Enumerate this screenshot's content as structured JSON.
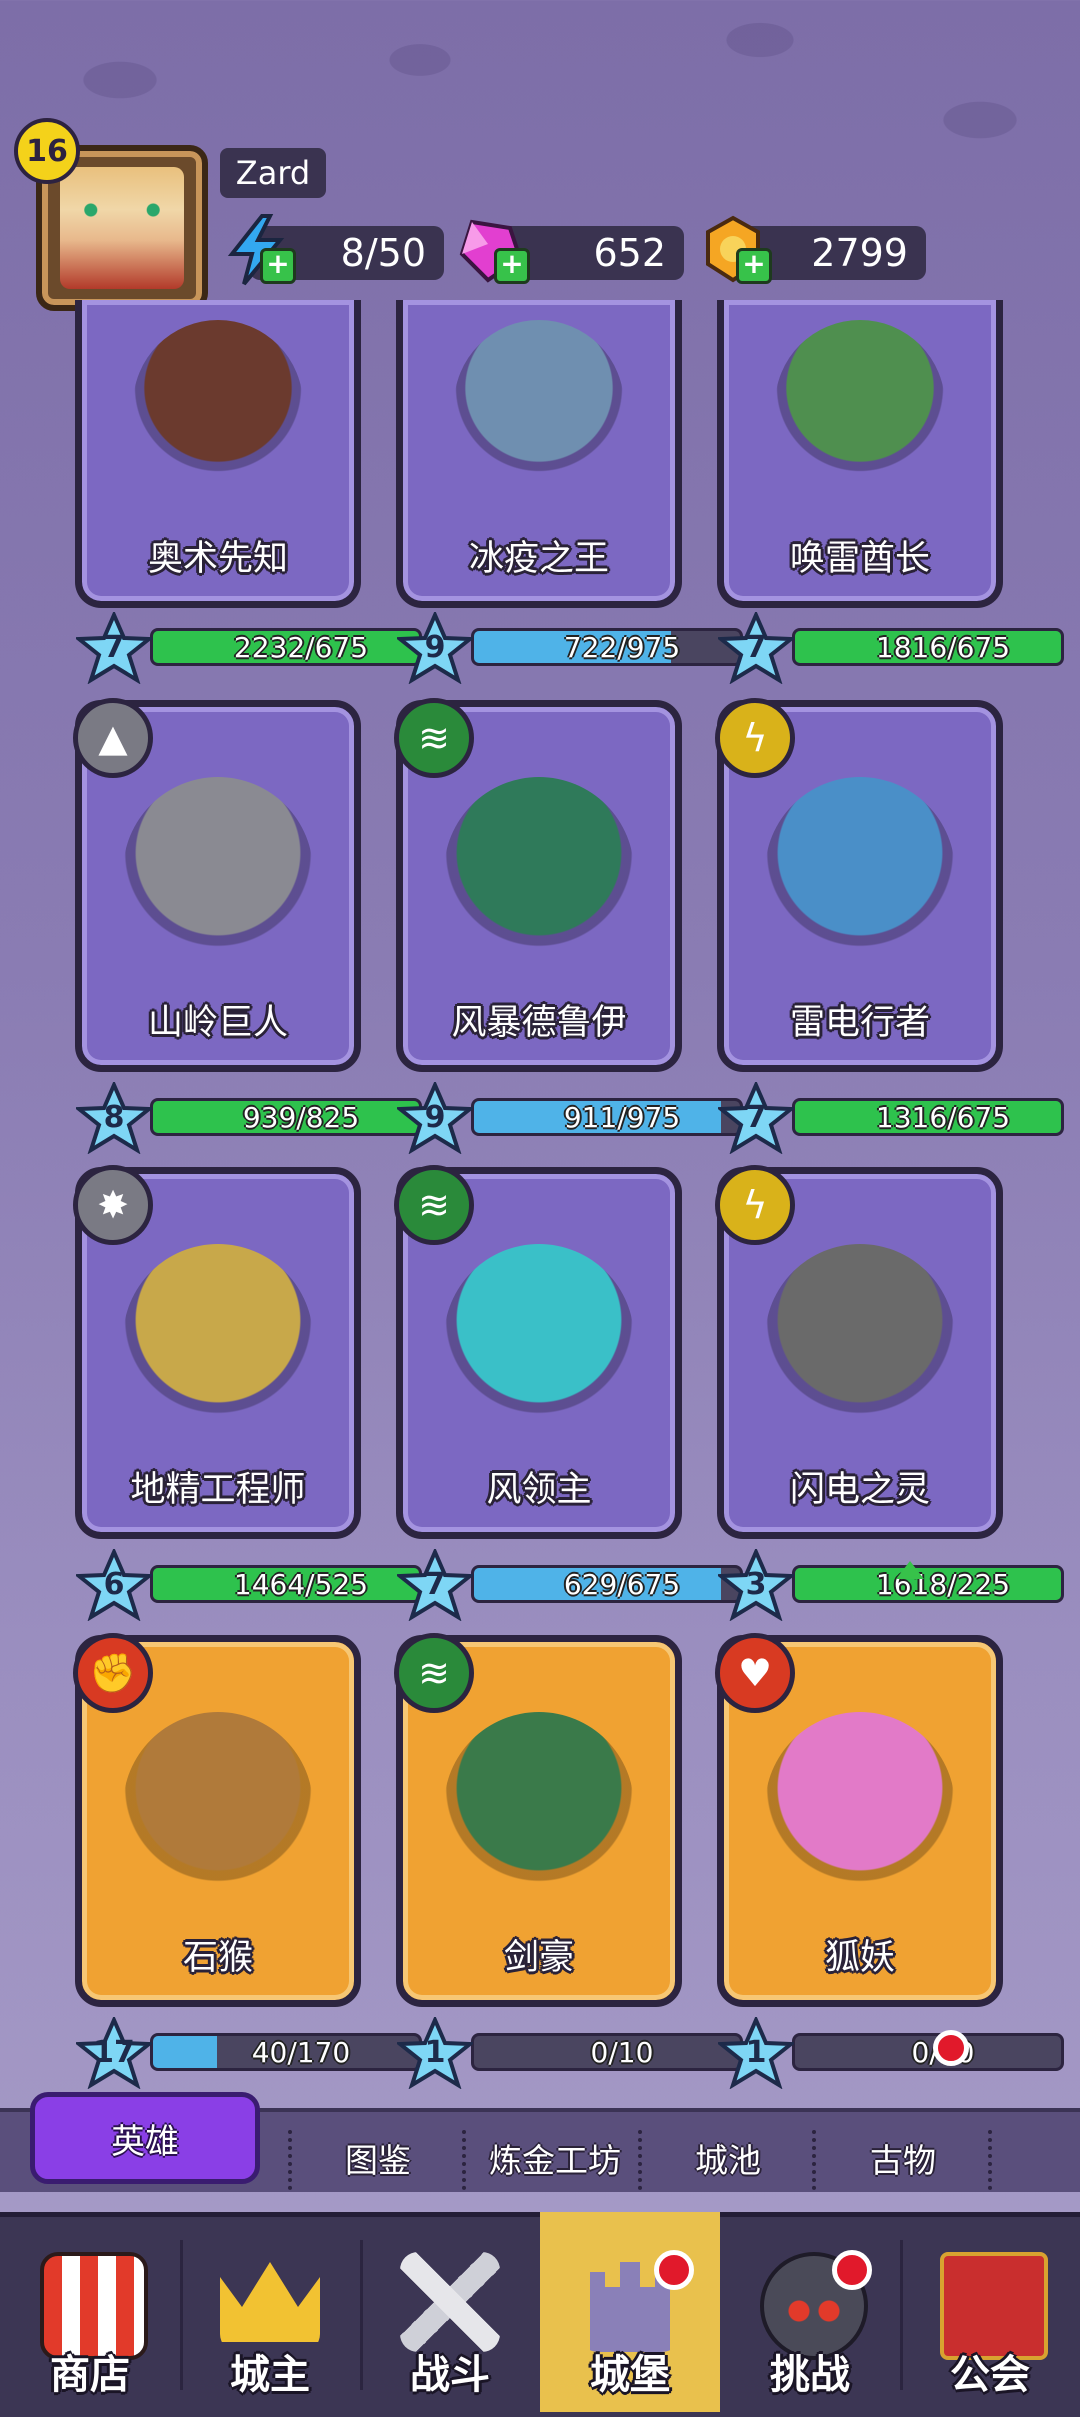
{
  "player": {
    "level": "16",
    "name": "Zard"
  },
  "resources": {
    "energy": "8/50",
    "gems": "652",
    "gold": "2799"
  },
  "heroes": [
    {
      "name": "奥术先知",
      "level": "7",
      "progress": "2232/675",
      "fill": 1.0,
      "bar_color": "#2ec24d",
      "element": "",
      "rarity": "epic"
    },
    {
      "name": "冰疫之王",
      "level": "9",
      "progress": "722/975",
      "fill": 0.74,
      "bar_color": "#4fb3e8",
      "element": "",
      "rarity": "epic"
    },
    {
      "name": "唤雷酋长",
      "level": "7",
      "progress": "1816/675",
      "fill": 1.0,
      "bar_color": "#2ec24d",
      "element": "",
      "rarity": "epic"
    },
    {
      "name": "山岭巨人",
      "level": "8",
      "progress": "939/825",
      "fill": 1.0,
      "bar_color": "#2ec24d",
      "element": "rock",
      "rarity": "epic"
    },
    {
      "name": "风暴德鲁伊",
      "level": "9",
      "progress": "911/975",
      "fill": 0.93,
      "bar_color": "#4fb3e8",
      "element": "wind",
      "rarity": "epic"
    },
    {
      "name": "雷电行者",
      "level": "7",
      "progress": "1316/675",
      "fill": 1.0,
      "bar_color": "#2ec24d",
      "element": "lightning",
      "rarity": "epic"
    },
    {
      "name": "地精工程师",
      "level": "6",
      "progress": "1464/525",
      "fill": 1.0,
      "bar_color": "#2ec24d",
      "element": "explosion",
      "rarity": "epic"
    },
    {
      "name": "风领主",
      "level": "7",
      "progress": "629/675",
      "fill": 0.93,
      "bar_color": "#4fb3e8",
      "element": "wind",
      "rarity": "epic"
    },
    {
      "name": "闪电之灵",
      "level": "3",
      "progress": "1618/225",
      "fill": 1.0,
      "bar_color": "#2ec24d",
      "element": "lightning",
      "rarity": "epic",
      "upgrade": true
    },
    {
      "name": "石猴",
      "level": "17",
      "progress": "40/170",
      "fill": 0.24,
      "bar_color": "#4fb3e8",
      "element": "power",
      "rarity": "legendary"
    },
    {
      "name": "剑豪",
      "level": "1",
      "progress": "0/10",
      "fill": 0.0,
      "bar_color": "#4fb3e8",
      "element": "wind",
      "rarity": "legendary"
    },
    {
      "name": "狐妖",
      "level": "1",
      "progress": "0/10",
      "fill": 0.0,
      "bar_color": "#4fb3e8",
      "element": "heart",
      "rarity": "legendary"
    }
  ],
  "subtabs": {
    "active": "英雄",
    "items": [
      "图鉴",
      "炼金工坊",
      "城池",
      "古物"
    ]
  },
  "bottom_nav": [
    "商店",
    "城主",
    "战斗",
    "城堡",
    "挑战",
    "公会"
  ]
}
